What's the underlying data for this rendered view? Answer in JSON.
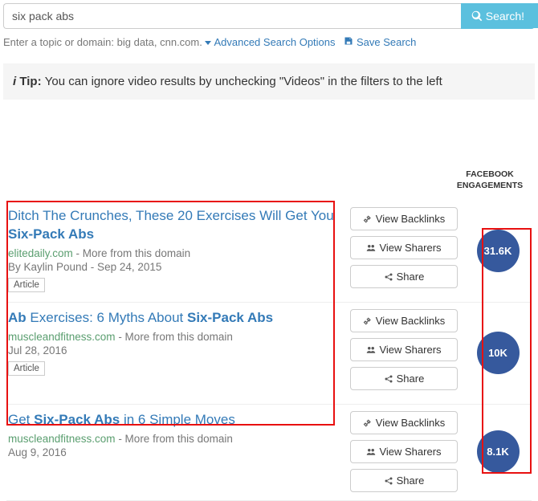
{
  "search": {
    "value": "six pack abs",
    "button": "Search!"
  },
  "sub": {
    "hint": "Enter a topic or domain: big data, cnn.com. ",
    "adv": "Advanced Search Options",
    "save": "Save Search"
  },
  "tip": {
    "prefix": "Tip: ",
    "text": "You can ignore video results by unchecking \"Videos\" in the filters to the left"
  },
  "header": {
    "engagements": "FACEBOOK ENGAGEMENTS"
  },
  "actions": {
    "backlinks": "View Backlinks",
    "sharers": "View Sharers",
    "share": "Share"
  },
  "more": " - More from this domain",
  "tag": "Article",
  "items": [
    {
      "title_pre": "Ditch The Crunches, These 20 Exercises Will Get You ",
      "title_q": "Six-Pack Abs",
      "title_post": "",
      "domain": "elitedaily.com",
      "byline": "By Kaylin Pound - Sep 24, 2015",
      "eng": "31.6K",
      "show_tag": true
    },
    {
      "title_pre": "",
      "title_q": "Ab",
      "title_mid": " Exercises: 6 Myths About ",
      "title_q2": "Six-Pack Abs",
      "title_post": "",
      "domain": "muscleandfitness.com",
      "byline": "Jul 28, 2016",
      "eng": "10K",
      "show_tag": true
    },
    {
      "title_pre": "Get ",
      "title_q": "Six-Pack Abs",
      "title_post": " in 6 Simple Moves",
      "domain": "muscleandfitness.com",
      "byline": "Aug 9, 2016",
      "eng": "8.1K",
      "show_tag": false
    }
  ]
}
